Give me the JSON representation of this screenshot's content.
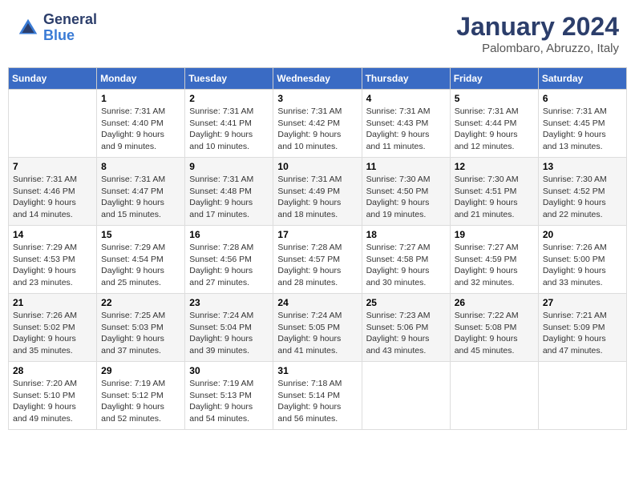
{
  "header": {
    "logo_general": "General",
    "logo_blue": "Blue",
    "month_title": "January 2024",
    "subtitle": "Palombaro, Abruzzo, Italy"
  },
  "calendar": {
    "days_of_week": [
      "Sunday",
      "Monday",
      "Tuesday",
      "Wednesday",
      "Thursday",
      "Friday",
      "Saturday"
    ],
    "weeks": [
      [
        {
          "day": "",
          "info": ""
        },
        {
          "day": "1",
          "info": "Sunrise: 7:31 AM\nSunset: 4:40 PM\nDaylight: 9 hours\nand 9 minutes."
        },
        {
          "day": "2",
          "info": "Sunrise: 7:31 AM\nSunset: 4:41 PM\nDaylight: 9 hours\nand 10 minutes."
        },
        {
          "day": "3",
          "info": "Sunrise: 7:31 AM\nSunset: 4:42 PM\nDaylight: 9 hours\nand 10 minutes."
        },
        {
          "day": "4",
          "info": "Sunrise: 7:31 AM\nSunset: 4:43 PM\nDaylight: 9 hours\nand 11 minutes."
        },
        {
          "day": "5",
          "info": "Sunrise: 7:31 AM\nSunset: 4:44 PM\nDaylight: 9 hours\nand 12 minutes."
        },
        {
          "day": "6",
          "info": "Sunrise: 7:31 AM\nSunset: 4:45 PM\nDaylight: 9 hours\nand 13 minutes."
        }
      ],
      [
        {
          "day": "7",
          "info": "Sunrise: 7:31 AM\nSunset: 4:46 PM\nDaylight: 9 hours\nand 14 minutes."
        },
        {
          "day": "8",
          "info": "Sunrise: 7:31 AM\nSunset: 4:47 PM\nDaylight: 9 hours\nand 15 minutes."
        },
        {
          "day": "9",
          "info": "Sunrise: 7:31 AM\nSunset: 4:48 PM\nDaylight: 9 hours\nand 17 minutes."
        },
        {
          "day": "10",
          "info": "Sunrise: 7:31 AM\nSunset: 4:49 PM\nDaylight: 9 hours\nand 18 minutes."
        },
        {
          "day": "11",
          "info": "Sunrise: 7:30 AM\nSunset: 4:50 PM\nDaylight: 9 hours\nand 19 minutes."
        },
        {
          "day": "12",
          "info": "Sunrise: 7:30 AM\nSunset: 4:51 PM\nDaylight: 9 hours\nand 21 minutes."
        },
        {
          "day": "13",
          "info": "Sunrise: 7:30 AM\nSunset: 4:52 PM\nDaylight: 9 hours\nand 22 minutes."
        }
      ],
      [
        {
          "day": "14",
          "info": "Sunrise: 7:29 AM\nSunset: 4:53 PM\nDaylight: 9 hours\nand 23 minutes."
        },
        {
          "day": "15",
          "info": "Sunrise: 7:29 AM\nSunset: 4:54 PM\nDaylight: 9 hours\nand 25 minutes."
        },
        {
          "day": "16",
          "info": "Sunrise: 7:28 AM\nSunset: 4:56 PM\nDaylight: 9 hours\nand 27 minutes."
        },
        {
          "day": "17",
          "info": "Sunrise: 7:28 AM\nSunset: 4:57 PM\nDaylight: 9 hours\nand 28 minutes."
        },
        {
          "day": "18",
          "info": "Sunrise: 7:27 AM\nSunset: 4:58 PM\nDaylight: 9 hours\nand 30 minutes."
        },
        {
          "day": "19",
          "info": "Sunrise: 7:27 AM\nSunset: 4:59 PM\nDaylight: 9 hours\nand 32 minutes."
        },
        {
          "day": "20",
          "info": "Sunrise: 7:26 AM\nSunset: 5:00 PM\nDaylight: 9 hours\nand 33 minutes."
        }
      ],
      [
        {
          "day": "21",
          "info": "Sunrise: 7:26 AM\nSunset: 5:02 PM\nDaylight: 9 hours\nand 35 minutes."
        },
        {
          "day": "22",
          "info": "Sunrise: 7:25 AM\nSunset: 5:03 PM\nDaylight: 9 hours\nand 37 minutes."
        },
        {
          "day": "23",
          "info": "Sunrise: 7:24 AM\nSunset: 5:04 PM\nDaylight: 9 hours\nand 39 minutes."
        },
        {
          "day": "24",
          "info": "Sunrise: 7:24 AM\nSunset: 5:05 PM\nDaylight: 9 hours\nand 41 minutes."
        },
        {
          "day": "25",
          "info": "Sunrise: 7:23 AM\nSunset: 5:06 PM\nDaylight: 9 hours\nand 43 minutes."
        },
        {
          "day": "26",
          "info": "Sunrise: 7:22 AM\nSunset: 5:08 PM\nDaylight: 9 hours\nand 45 minutes."
        },
        {
          "day": "27",
          "info": "Sunrise: 7:21 AM\nSunset: 5:09 PM\nDaylight: 9 hours\nand 47 minutes."
        }
      ],
      [
        {
          "day": "28",
          "info": "Sunrise: 7:20 AM\nSunset: 5:10 PM\nDaylight: 9 hours\nand 49 minutes."
        },
        {
          "day": "29",
          "info": "Sunrise: 7:19 AM\nSunset: 5:12 PM\nDaylight: 9 hours\nand 52 minutes."
        },
        {
          "day": "30",
          "info": "Sunrise: 7:19 AM\nSunset: 5:13 PM\nDaylight: 9 hours\nand 54 minutes."
        },
        {
          "day": "31",
          "info": "Sunrise: 7:18 AM\nSunset: 5:14 PM\nDaylight: 9 hours\nand 56 minutes."
        },
        {
          "day": "",
          "info": ""
        },
        {
          "day": "",
          "info": ""
        },
        {
          "day": "",
          "info": ""
        }
      ]
    ]
  }
}
